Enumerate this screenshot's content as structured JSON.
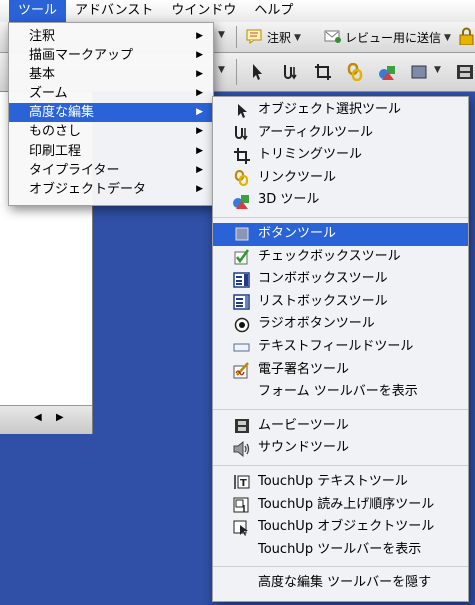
{
  "menubar": {
    "items": [
      "ツール",
      "アドバンスト",
      "ウインドウ",
      "ヘルプ"
    ]
  },
  "toolbar": {
    "comment_label": "注釈",
    "send_review_label": "レビュー用に送信"
  },
  "tools_menu": {
    "items": [
      {
        "label": "注釈"
      },
      {
        "label": "描画マークアップ"
      },
      {
        "label": "基本"
      },
      {
        "label": "ズーム"
      },
      {
        "label": "高度な編集"
      },
      {
        "label": "ものさし"
      },
      {
        "label": "印刷工程"
      },
      {
        "label": "タイプライター"
      },
      {
        "label": "オブジェクトデータ"
      }
    ]
  },
  "advanced_menu": {
    "groups": [
      [
        {
          "label": "オブジェクト選択ツール",
          "icon": "select-object-icon"
        },
        {
          "label": "アーティクルツール",
          "icon": "article-icon"
        },
        {
          "label": "トリミングツール",
          "icon": "crop-icon"
        },
        {
          "label": "リンクツール",
          "icon": "link-icon"
        },
        {
          "label": "3D ツール",
          "icon": "3d-icon"
        }
      ],
      [
        {
          "label": "ボタンツール",
          "icon": "button-icon"
        },
        {
          "label": "チェックボックスツール",
          "icon": "checkbox-icon"
        },
        {
          "label": "コンボボックスツール",
          "icon": "combobox-icon"
        },
        {
          "label": "リストボックスツール",
          "icon": "listbox-icon"
        },
        {
          "label": "ラジオボタンツール",
          "icon": "radio-icon"
        },
        {
          "label": "テキストフィールドツール",
          "icon": "textfield-icon"
        },
        {
          "label": "電子署名ツール",
          "icon": "signature-icon"
        },
        {
          "label": "フォーム ツールバーを表示",
          "icon": ""
        }
      ],
      [
        {
          "label": "ムービーツール",
          "icon": "movie-icon"
        },
        {
          "label": "サウンドツール",
          "icon": "sound-icon"
        }
      ],
      [
        {
          "label": "TouchUp テキストツール",
          "icon": "touchup-text-icon"
        },
        {
          "label": "TouchUp 読み上げ順序ツール",
          "icon": "reading-order-icon"
        },
        {
          "label": "TouchUp オブジェクトツール",
          "icon": "touchup-object-icon"
        },
        {
          "label": "TouchUp  ツールバーを表示",
          "icon": ""
        }
      ],
      [
        {
          "label": "高度な編集 ツールバーを隠す",
          "icon": ""
        }
      ]
    ]
  },
  "colors": {
    "highlight": "#2a62d8",
    "desktop": "#2f50a6"
  }
}
